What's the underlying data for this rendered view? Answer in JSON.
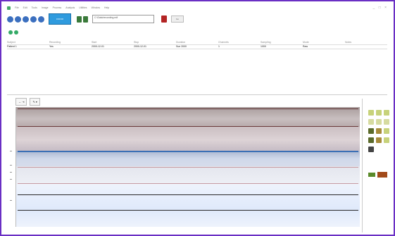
{
  "menubar": {
    "items": [
      "File",
      "Edit",
      "Tools",
      "Image",
      "Process",
      "Analysis",
      "Utilities",
      "Window",
      "Help"
    ]
  },
  "window": {
    "controls": "_ □ ×"
  },
  "toolbar": {
    "counter_text": "0:00:00",
    "search_value": "C:\\Data\\recording.edf",
    "grey_button_label": "Go"
  },
  "info": {
    "headers": [
      "Subject",
      "Recording",
      "Start",
      "Stop",
      "Duration",
      "Channels",
      "Sampling",
      "Mode",
      "Notes"
    ],
    "values": [
      "Patient 1",
      "Yes",
      "2000-12-01",
      "2000-12-01",
      "Sun 2000",
      "1",
      "1000",
      "Raw",
      ""
    ]
  },
  "colors": {
    "accent": "#6a2fc4",
    "toolbar_blue": "#2f9bde",
    "record_red": "#b32424"
  }
}
